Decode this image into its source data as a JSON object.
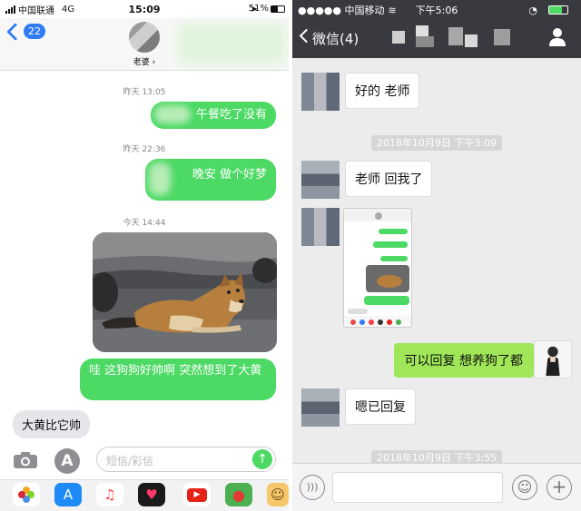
{
  "imessage": {
    "status": {
      "carrier": "中国联通",
      "network": "4G",
      "time": "15:09",
      "battery": "51%"
    },
    "header": {
      "back_count": "22",
      "contact_name": "老婆 ›"
    },
    "messages": [
      {
        "time": "昨天 13:05",
        "text": "午餐吃了没有"
      },
      {
        "time": "昨天 22:36",
        "text": "晚安 做个好梦"
      },
      {
        "time": "今天 14:44",
        "text": "哇 这狗狗好帅啊 突然想到了大黄"
      }
    ],
    "received": "大黄比它帅",
    "input_placeholder": "短信/彩信",
    "tray_icons": [
      "photos-icon",
      "appstore-icon",
      "music-icon",
      "heart-app-icon",
      "video-icon",
      "maps-icon",
      "sticker-icon"
    ],
    "colors": {
      "sent_bubble": "#4cd964",
      "accent": "#2f7cf6"
    }
  },
  "wechat": {
    "status": {
      "carrier": "●●●●● 中国移动",
      "time": "下午5:06"
    },
    "title": "微信(4)",
    "messages": [
      {
        "text": "好的 老师"
      },
      {
        "timestamp": "2018年10月9日 下午3:09"
      },
      {
        "text": "老师 回我了"
      },
      {
        "image": "screenshot-thumb"
      },
      {
        "sent": "可以回复 想养狗了都"
      },
      {
        "text": "嗯已回复"
      },
      {
        "timestamp": "2018年10月9日 下午3:55"
      }
    ],
    "colors": {
      "header": "#393a3f",
      "sent_bubble": "#9fe658"
    }
  }
}
